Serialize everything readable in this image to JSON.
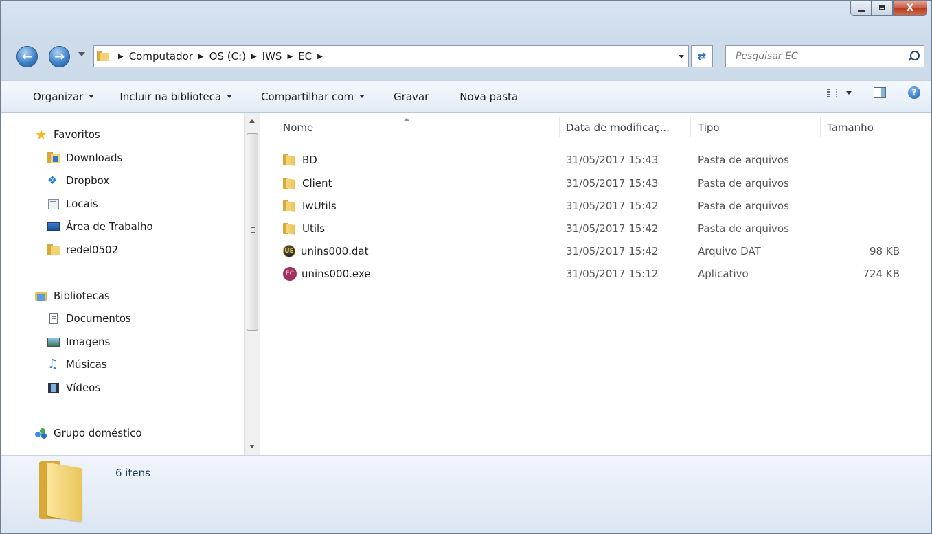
{
  "window": {
    "close_label": "X"
  },
  "address": {
    "crumbs": [
      "Computador",
      "OS (C:)",
      "IWS",
      "EC"
    ]
  },
  "search": {
    "placeholder": "Pesquisar EC"
  },
  "toolbar": {
    "organize": "Organizar",
    "include": "Incluir na biblioteca",
    "share": "Compartilhar com",
    "burn": "Gravar",
    "new_folder": "Nova pasta",
    "help": "?"
  },
  "nav": {
    "favorites_header": "Favoritos",
    "favorites": [
      {
        "label": "Downloads",
        "icon": "downloads-folder-icon"
      },
      {
        "label": "Dropbox",
        "icon": "dropbox-icon"
      },
      {
        "label": "Locais",
        "icon": "recent-places-icon"
      },
      {
        "label": "Área de Trabalho",
        "icon": "desktop-icon"
      },
      {
        "label": "redel0502",
        "icon": "folder-icon"
      }
    ],
    "libraries_header": "Bibliotecas",
    "libraries": [
      {
        "label": "Documentos",
        "icon": "documents-icon"
      },
      {
        "label": "Imagens",
        "icon": "pictures-icon"
      },
      {
        "label": "Músicas",
        "icon": "music-icon"
      },
      {
        "label": "Vídeos",
        "icon": "videos-icon"
      }
    ],
    "homegroup": "Grupo doméstico"
  },
  "columns": {
    "name": "Nome",
    "date": "Data de modificaç...",
    "type": "Tipo",
    "size": "Tamanho"
  },
  "files": [
    {
      "name": "BD",
      "date": "31/05/2017 15:43",
      "type": "Pasta de arquivos",
      "size": "",
      "icon": "folder-icon"
    },
    {
      "name": "Client",
      "date": "31/05/2017 15:43",
      "type": "Pasta de arquivos",
      "size": "",
      "icon": "folder-icon"
    },
    {
      "name": "IwUtils",
      "date": "31/05/2017 15:42",
      "type": "Pasta de arquivos",
      "size": "",
      "icon": "folder-icon"
    },
    {
      "name": "Utils",
      "date": "31/05/2017 15:42",
      "type": "Pasta de arquivos",
      "size": "",
      "icon": "folder-icon"
    },
    {
      "name": "unins000.dat",
      "date": "31/05/2017 15:42",
      "type": "Arquivo DAT",
      "size": "98 KB",
      "icon": "ultraedit-file-icon"
    },
    {
      "name": "unins000.exe",
      "date": "31/05/2017 15:12",
      "type": "Aplicativo",
      "size": "724 KB",
      "icon": "ec-app-icon"
    }
  ],
  "status": {
    "item_count": "6 itens"
  }
}
